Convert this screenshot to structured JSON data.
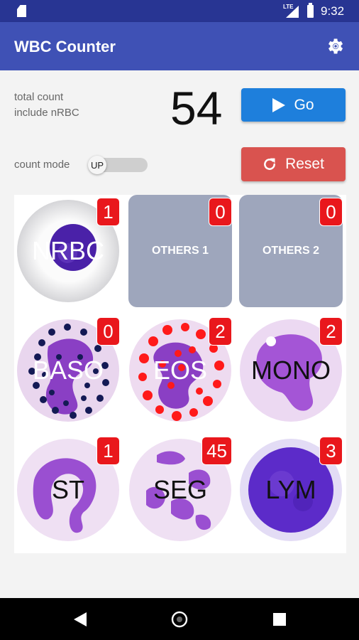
{
  "status_bar": {
    "network": "LTE",
    "time": "9:32"
  },
  "app_bar": {
    "title": "WBC Counter",
    "settings_icon": "gear-icon"
  },
  "controls": {
    "total_count_label_line1": "total count",
    "total_count_label_line2": "include nRBC",
    "total_count": "54",
    "go_label": "Go",
    "count_mode_label": "count mode",
    "count_mode_value": "UP",
    "reset_label": "Reset"
  },
  "cells": [
    {
      "name": "NRBC",
      "count": "1"
    },
    {
      "name": "OTHERS 1",
      "count": "0"
    },
    {
      "name": "OTHERS 2",
      "count": "0"
    },
    {
      "name": "BASO",
      "count": "0"
    },
    {
      "name": "EOS",
      "count": "2"
    },
    {
      "name": "MONO",
      "count": "2"
    },
    {
      "name": "ST",
      "count": "1"
    },
    {
      "name": "SEG",
      "count": "45"
    },
    {
      "name": "LYM",
      "count": "3"
    }
  ],
  "colors": {
    "app_bar": "#3f51b5",
    "status_bar": "#283593",
    "go": "#1e7fdc",
    "reset": "#d9534f",
    "badge": "#e9171c"
  },
  "nav_bar": {
    "icons": [
      "back-icon",
      "home-icon",
      "recents-icon"
    ]
  }
}
